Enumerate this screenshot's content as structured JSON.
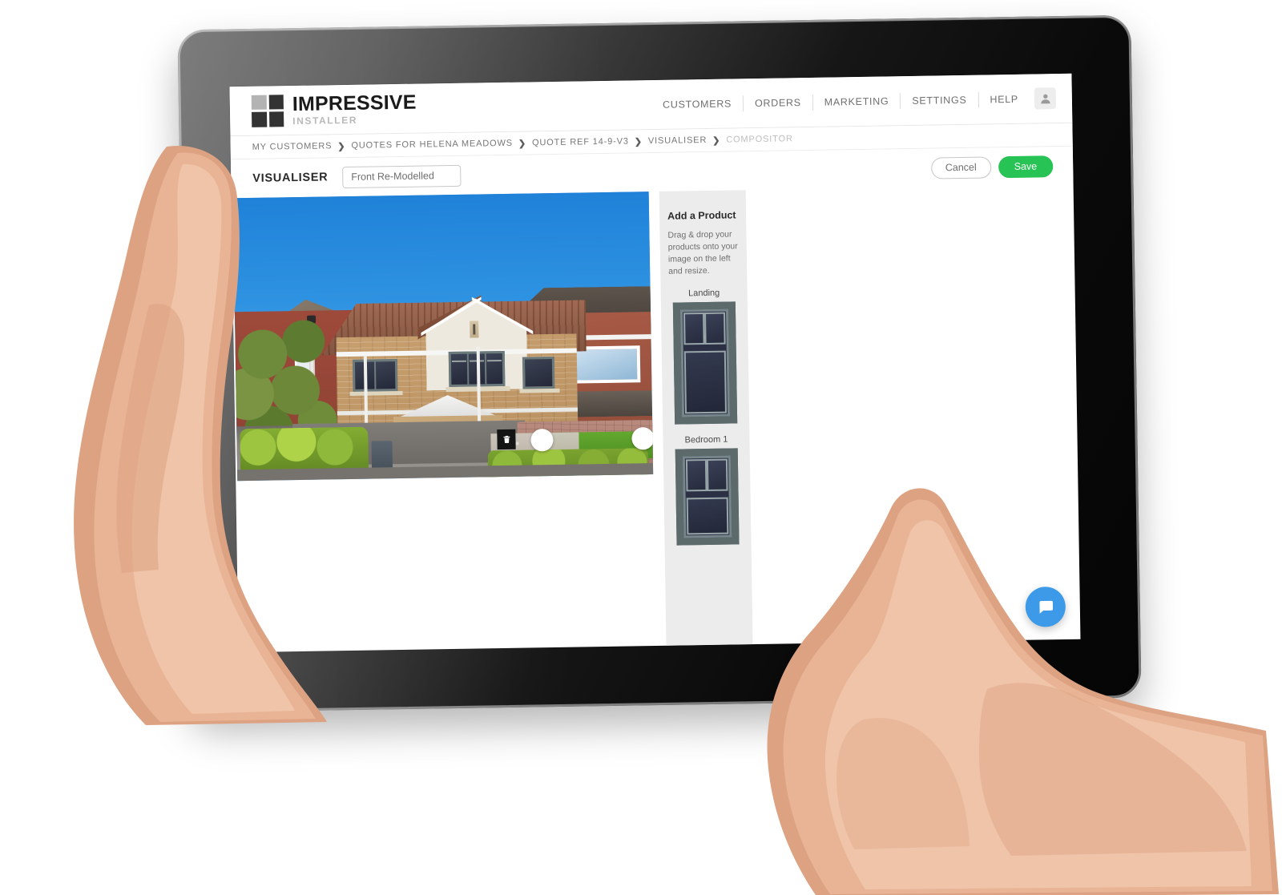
{
  "app": {
    "brand_name": "IMPRESSIVE",
    "brand_sub": "INSTALLER"
  },
  "topnav": {
    "items": [
      {
        "label": "CUSTOMERS"
      },
      {
        "label": "ORDERS"
      },
      {
        "label": "MARKETING"
      },
      {
        "label": "SETTINGS"
      },
      {
        "label": "HELP"
      }
    ],
    "avatar_icon": "user-avatar-icon"
  },
  "breadcrumb": {
    "separator": "❯",
    "items": [
      {
        "label": "MY CUSTOMERS",
        "current": false
      },
      {
        "label": "QUOTES FOR HELENA MEADOWS",
        "current": false
      },
      {
        "label": "QUOTE REF 14-9-V3",
        "current": false
      },
      {
        "label": "VISUALISER",
        "current": false
      },
      {
        "label": "COMPOSITOR",
        "current": true
      }
    ]
  },
  "toolbar": {
    "title": "VISUALISER",
    "name_value": "Front Re-Modelled",
    "name_placeholder": "Front Re-Modelled",
    "cancel_label": "Cancel",
    "save_label": "Save",
    "save_color": "#27c355"
  },
  "canvas": {
    "delete_icon": "trash-icon",
    "handle_icon": "resize-handle",
    "handles": 4,
    "selected_product": "Bedroom 1 window"
  },
  "side_panel": {
    "title": "Add a Product",
    "description": "Drag & drop your products onto your image on the left and resize.",
    "products": [
      {
        "name": "Landing"
      },
      {
        "name": "Bedroom 1"
      }
    ]
  },
  "chat": {
    "icon": "chat-bubble-icon",
    "color": "#3d9ae8"
  }
}
